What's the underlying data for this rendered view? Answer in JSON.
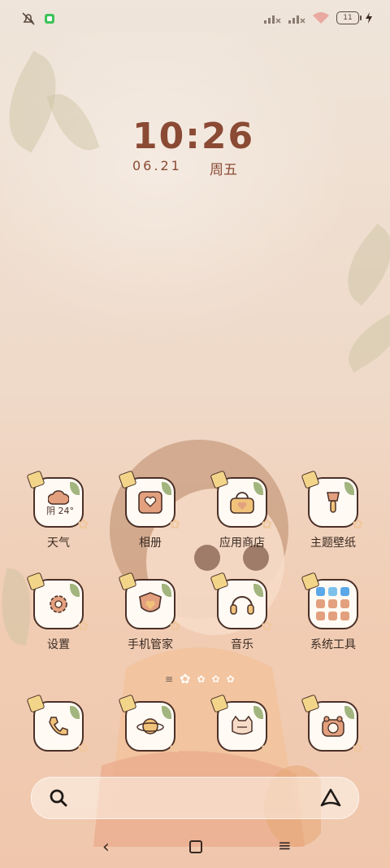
{
  "status_bar": {
    "left_icons": [
      "bell-off-icon",
      "app-notification-icon"
    ],
    "right_icons": [
      "signal-off-icon",
      "signal-off-icon",
      "wifi-icon",
      "battery-icon",
      "charging-icon"
    ],
    "battery_level": "11"
  },
  "clock": {
    "time": "10:26",
    "date": "06.21",
    "weekday": "周五"
  },
  "weather_widget_text": "阴 24°",
  "apps_row1": [
    {
      "label": "天气",
      "icon": "weather-icon"
    },
    {
      "label": "相册",
      "icon": "gallery-icon"
    },
    {
      "label": "应用商店",
      "icon": "app-store-icon"
    },
    {
      "label": "主题壁纸",
      "icon": "theme-icon"
    }
  ],
  "apps_row2": [
    {
      "label": "设置",
      "icon": "settings-icon"
    },
    {
      "label": "手机管家",
      "icon": "security-icon"
    },
    {
      "label": "音乐",
      "icon": "music-icon"
    },
    {
      "label": "系统工具",
      "icon": "folder-icon"
    }
  ],
  "dock": [
    {
      "icon": "phone-icon"
    },
    {
      "icon": "browser-icon"
    },
    {
      "icon": "messages-icon"
    },
    {
      "icon": "camera-icon"
    }
  ],
  "search": {
    "icons": [
      "search-icon",
      "assistant-icon"
    ]
  },
  "nav": {
    "back": "‹",
    "menu": "≡"
  },
  "colors": {
    "accent": "#8a4a34",
    "outline": "#4b3027",
    "tile": "#fffaf4"
  }
}
